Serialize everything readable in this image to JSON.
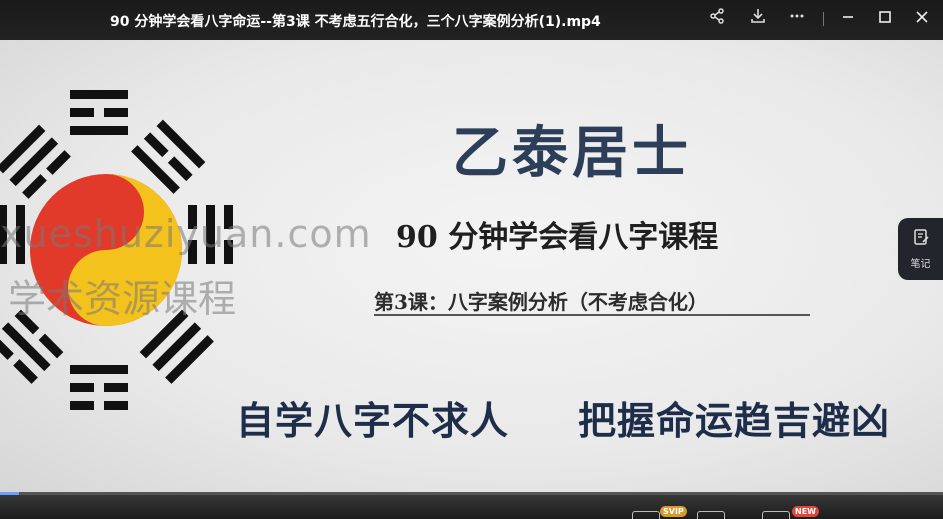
{
  "window": {
    "title": "90 分钟学会看八字命运--第3课 不考虑五行合化，三个八字案例分析(1).mp4",
    "icons": [
      "share-icon",
      "download-icon",
      "more-icon",
      "minimize-icon",
      "maximize-icon",
      "close-icon"
    ]
  },
  "slide": {
    "author": "乙泰居士",
    "course": "90  分钟学会看八字课程",
    "lesson": "第3课：八字案例分析（不考虑合化）",
    "slogan_left": "自学八字不求人",
    "slogan_right": "把握命运趋吉避凶"
  },
  "watermark": {
    "line1": "xueshuziyuan.com",
    "line2": "学术资源课程"
  },
  "notes_tab": {
    "label": "笔记",
    "icon": "notes-icon"
  },
  "controls": {
    "badges": {
      "svip": "SVIP",
      "new": "NEW"
    }
  },
  "colors": {
    "accent": "#6aa0ff",
    "title_text": "#2c3e58",
    "notes_bg": "#22262c"
  }
}
